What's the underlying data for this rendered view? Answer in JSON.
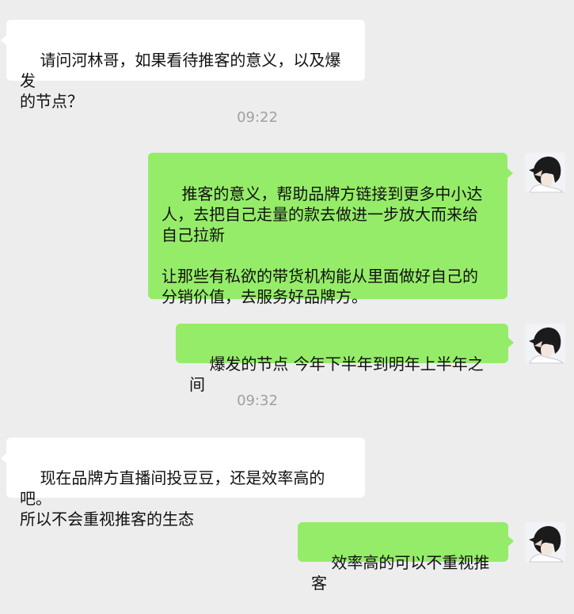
{
  "messages": [
    {
      "id": "m1",
      "side": "in",
      "text": "请问河林哥，如果看待推客的意义，以及爆发\n的节点？"
    },
    {
      "id": "t1",
      "type": "timestamp",
      "text": "09:22"
    },
    {
      "id": "m2",
      "side": "out",
      "text": "推客的意义，帮助品牌方链接到更多中小达\n人，去把自己走量的款去做进一步放大而来给\n自己拉新\n\n让那些有私欲的带货机构能从里面做好自己的\n分销价值，去服务好品牌方。"
    },
    {
      "id": "m3",
      "side": "out",
      "text": "爆发的节点 今年下半年到明年上半年之间"
    },
    {
      "id": "t2",
      "type": "timestamp",
      "text": "09:32"
    },
    {
      "id": "m4",
      "side": "in",
      "text": "现在品牌方直播间投豆豆，还是效率高的吧。\n所以不会重视推客的生态"
    },
    {
      "id": "m5",
      "side": "out",
      "text": "效率高的可以不重视推客"
    }
  ],
  "colors": {
    "background": "#ededed",
    "incoming_bubble": "#ffffff",
    "outgoing_bubble": "#95ec69",
    "timestamp_text": "#a0a0a0"
  },
  "icons": {
    "avatar": "user-avatar-icon"
  }
}
